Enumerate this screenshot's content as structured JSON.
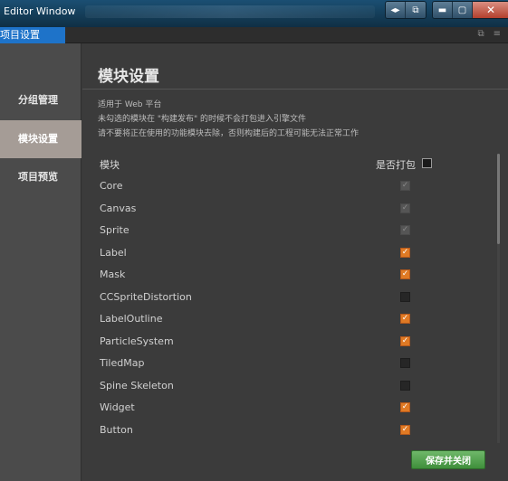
{
  "window": {
    "title": "Editor Window",
    "buttons": {
      "group1": [
        "◂▸",
        "⧉"
      ],
      "group2": [
        "▬",
        "▢"
      ],
      "close": "✕"
    }
  },
  "tab": {
    "label": "项目设置",
    "icons": [
      "restore-icon",
      "menu-icon"
    ]
  },
  "sidebar": {
    "items": [
      {
        "label": "分组管理"
      },
      {
        "label": "模块设置",
        "active": true
      },
      {
        "label": "项目预览"
      }
    ]
  },
  "main": {
    "heading": "模块设置",
    "desc": [
      "适用于 Web 平台",
      "未勾选的模块在 \"构建发布\" 的时候不会打包进入引擎文件",
      "请不要将正在使用的功能模块去除，否则构建后的工程可能无法正常工作"
    ],
    "col_module": "模块",
    "col_pack": "是否打包",
    "modules": [
      {
        "name": "Core",
        "state": "disabled"
      },
      {
        "name": "Canvas",
        "state": "disabled"
      },
      {
        "name": "Sprite",
        "state": "disabled"
      },
      {
        "name": "Label",
        "state": "checked"
      },
      {
        "name": "Mask",
        "state": "checked"
      },
      {
        "name": "CCSpriteDistortion",
        "state": "unchecked"
      },
      {
        "name": "LabelOutline",
        "state": "checked"
      },
      {
        "name": "ParticleSystem",
        "state": "checked"
      },
      {
        "name": "TiledMap",
        "state": "unchecked"
      },
      {
        "name": "Spine Skeleton",
        "state": "unchecked"
      },
      {
        "name": "Widget",
        "state": "checked"
      },
      {
        "name": "Button",
        "state": "checked"
      }
    ],
    "save_label": "保存并关闭"
  },
  "colors": {
    "accent_tab": "#1e73c9",
    "checkbox_checked": "#e07a24",
    "save_button": "#4a9a45",
    "sidebar_active": "#a59c96"
  }
}
